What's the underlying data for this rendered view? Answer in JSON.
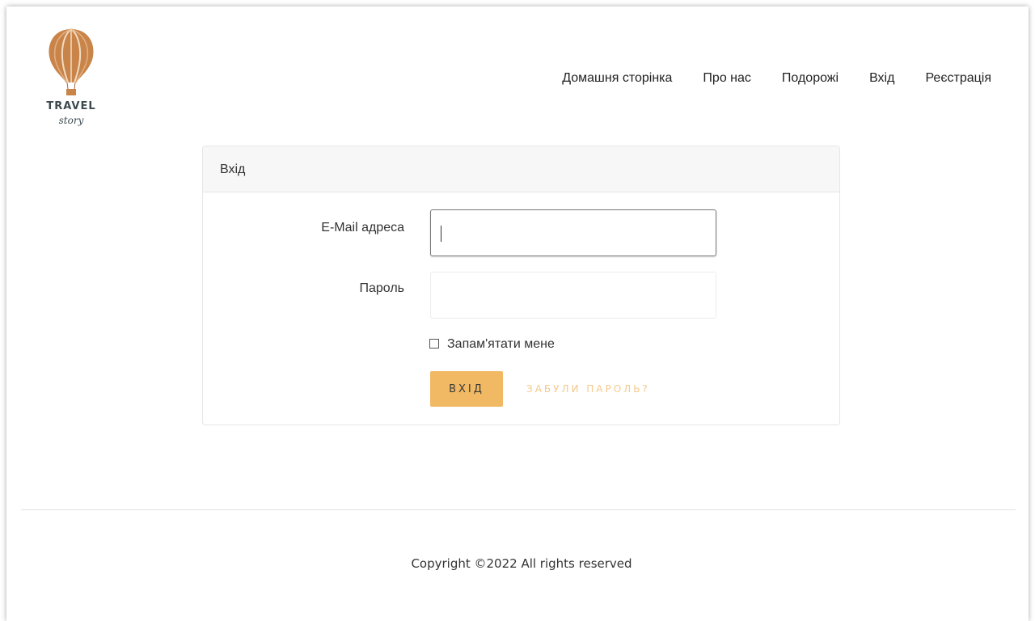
{
  "brand": {
    "logo_text": "TRAVEL",
    "logo_subtext": "story",
    "colors": {
      "balloon": "#c9844a",
      "accent": "#f1b963",
      "link_accent": "#f6c98b"
    }
  },
  "nav": {
    "items": [
      {
        "label": "Домашня сторінка"
      },
      {
        "label": "Про нас"
      },
      {
        "label": "Подорожі"
      },
      {
        "label": "Вхід"
      },
      {
        "label": "Реєстрація"
      }
    ]
  },
  "login_card": {
    "header": "Вхід",
    "email_label": "E-Mail адреса",
    "email_value": "",
    "password_label": "Пароль",
    "password_value": "",
    "remember_label": "Запам'ятати мене",
    "remember_checked": false,
    "submit_label": "ВХІД",
    "forgot_label": "ЗАБУЛИ ПАРОЛЬ?"
  },
  "footer": {
    "copyright": "Copyright ©2022 All rights reserved"
  }
}
